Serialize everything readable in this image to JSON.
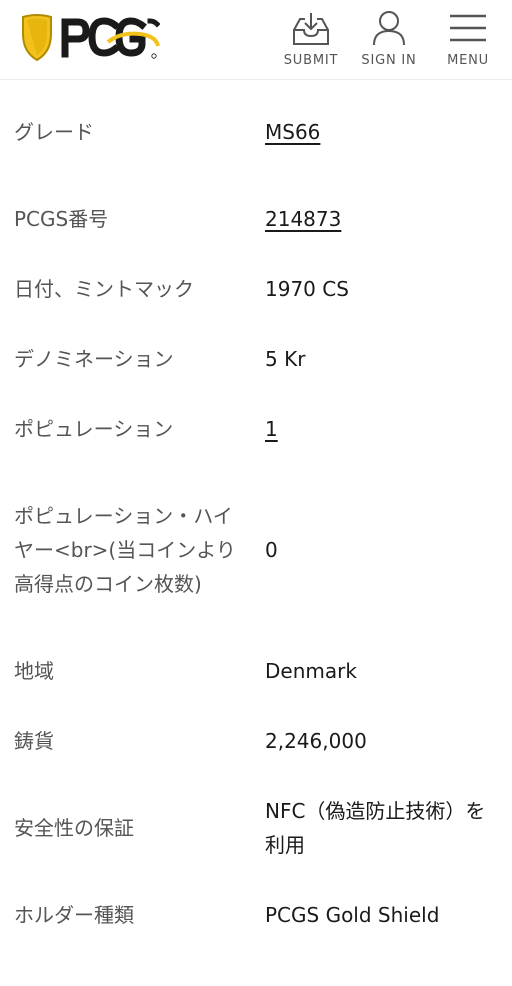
{
  "header": {
    "brand": "PCGS",
    "nav": {
      "submit": "SUBMIT",
      "sign_in": "SIGN IN",
      "menu": "MENU"
    },
    "icons": {
      "logo": "pcgs-shield-logo",
      "submit": "tray-download-icon",
      "sign_in": "user-icon",
      "menu": "hamburger-icon"
    },
    "colors": {
      "shield": "#f2c21a",
      "shield_edge": "#b08a00",
      "text_dark": "#1a1a1a",
      "nav_label": "#555555"
    }
  },
  "specs": [
    {
      "label": "グレード",
      "value": "MS66",
      "link": true
    },
    {
      "label": "PCGS番号",
      "value": "214873",
      "link": true
    },
    {
      "label": "日付、ミントマック",
      "value": "1970 CS",
      "link": false
    },
    {
      "label": "デノミネーション",
      "value": "5 Kr",
      "link": false
    },
    {
      "label": "ポピュレーション",
      "value": "1",
      "link": true
    },
    {
      "label": "ポピュレーション・ハイヤー<br>(当コインより高得点のコイン枚数)",
      "value": "0",
      "link": false
    },
    {
      "label": "地域",
      "value": "Denmark",
      "link": false
    },
    {
      "label": "鋳貨",
      "value": "2,246,000",
      "link": false
    },
    {
      "label": "安全性の保証",
      "value": "NFC（偽造防止技術）を利用",
      "link": false
    },
    {
      "label": "ホルダー種類",
      "value": "PCGS Gold Shield",
      "link": false
    }
  ]
}
